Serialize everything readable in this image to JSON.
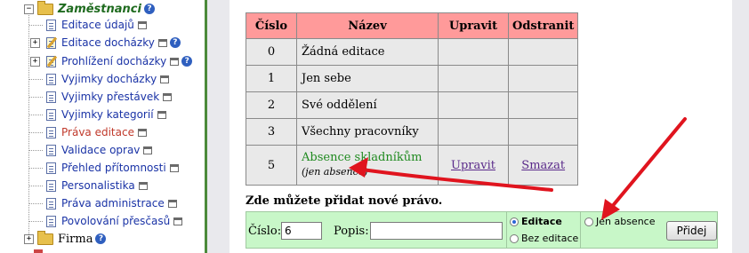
{
  "sidebar": {
    "zamestnanci": "Zaměstnanci",
    "items": [
      {
        "label": "Editace údajů",
        "expand": false,
        "icon": "page"
      },
      {
        "label": "Editace docházky",
        "expand": true,
        "icon": "edit"
      },
      {
        "label": "Prohlížení docházky",
        "expand": true,
        "icon": "edit"
      },
      {
        "label": "Vyjimky docházky",
        "icon": "page"
      },
      {
        "label": "Vyjimky přestávek",
        "icon": "page"
      },
      {
        "label": "Vyjimky kategorií",
        "icon": "page"
      },
      {
        "label": "Práva editace",
        "icon": "page",
        "active": true
      },
      {
        "label": "Validace oprav",
        "icon": "page"
      },
      {
        "label": "Přehled přítomnosti",
        "icon": "page"
      },
      {
        "label": "Personalistika",
        "icon": "page"
      },
      {
        "label": "Práva administrace",
        "icon": "page"
      },
      {
        "label": "Povolování přesčasů",
        "icon": "page"
      }
    ],
    "firma": "Firma"
  },
  "table": {
    "headers": {
      "cislo": "Číslo",
      "nazev": "Název",
      "upravit": "Upravit",
      "odstranit": "Odstranit"
    },
    "rows": [
      {
        "num": "0",
        "name": "Žádná editace"
      },
      {
        "num": "1",
        "name": "Jen sebe"
      },
      {
        "num": "2",
        "name": "Své oddělení"
      },
      {
        "num": "3",
        "name": "Všechny pracovníky"
      },
      {
        "num": "5",
        "name": "Absence skladníkům",
        "note": "(jen absence)",
        "edit": "Upravit",
        "delete": "Smazat"
      }
    ]
  },
  "add_form": {
    "heading": "Zde můžete přidat nové právo.",
    "cislo_label": "Číslo:",
    "cislo_value": "6",
    "popis_label": "Popis:",
    "popis_value": "",
    "radio_editace": "Editace",
    "radio_bez_editace": "Bez editace",
    "radio_jen_absence": "Jen absence",
    "submit": "Přidej"
  },
  "colors": {
    "header_bg": "#ff9a9a",
    "form_bg": "#c8f7c8",
    "arrow": "#e0141e"
  }
}
